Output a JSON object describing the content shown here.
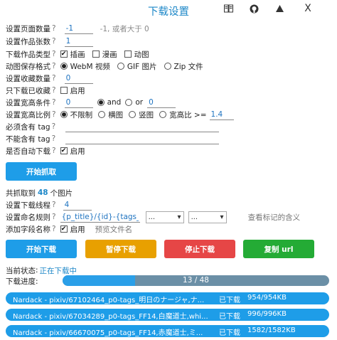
{
  "header": {
    "title": "下载设置",
    "icons": [
      "book-icon",
      "github-icon",
      "triangle-up-icon"
    ],
    "close": "X"
  },
  "settings": {
    "page_count": {
      "label": "设置页面数量",
      "q": "?",
      "value": "-1",
      "hint": "-1, 或者大于 0"
    },
    "work_count": {
      "label": "设置作品张数",
      "q": "?",
      "value": "1"
    },
    "download_type": {
      "label": "下载作品类型",
      "q": "?",
      "options": [
        {
          "label": "插画",
          "checked": true
        },
        {
          "label": "漫画",
          "checked": false
        },
        {
          "label": "动图",
          "checked": false
        }
      ]
    },
    "ugoira_format": {
      "label": "动图保存格式",
      "q": "?",
      "options": [
        {
          "label": "WebM 视频",
          "checked": true
        },
        {
          "label": "GIF 图片",
          "checked": false
        },
        {
          "label": "Zip 文件",
          "checked": false
        }
      ]
    },
    "bookmark_count": {
      "label": "设置收藏数量",
      "q": "?",
      "value": "0"
    },
    "only_bookmarked": {
      "label": "只下载已收藏",
      "q": "?",
      "option": "启用"
    },
    "size_condition": {
      "label": "设置宽高条件",
      "q": "?",
      "width": "0",
      "and": "and",
      "or": "or",
      "height": "0"
    },
    "ratio": {
      "label": "设置宽高比例",
      "q": "?",
      "options": [
        {
          "label": "不限制",
          "checked": true
        },
        {
          "label": "横图",
          "checked": false
        },
        {
          "label": "竖图",
          "checked": false
        },
        {
          "label": "宽高比 >=",
          "checked": false
        }
      ],
      "ratio_value": "1.4"
    },
    "must_tag": {
      "label": "必须含有 tag",
      "q": "?",
      "value": ""
    },
    "exclude_tag": {
      "label": "不能含有 tag",
      "q": "?",
      "value": ""
    },
    "auto_download": {
      "label": "是否自动下载",
      "q": "?",
      "option": "启用"
    }
  },
  "start_button": "开始抓取",
  "crawl_summary": {
    "prefix": "共抓取到",
    "count": "48",
    "suffix": "个图片"
  },
  "threads": {
    "label": "设置下载线程",
    "q": "?",
    "value": "4"
  },
  "naming": {
    "label": "设置命名规则",
    "q": "?",
    "value": "{p_title}/{id}-{tags_trar",
    "select1": "...",
    "select2": "...",
    "link": "查看标记的含义"
  },
  "add_field": {
    "label": "添加字段名称",
    "q": "?",
    "option": "启用",
    "preview": "预览文件名"
  },
  "actions": {
    "start": "开始下载",
    "pause": "暂停下载",
    "stop": "停止下载",
    "copy": "复制 url"
  },
  "state": {
    "label": "当前状态",
    "value": "正在下载中"
  },
  "progress": {
    "label": "下载进度:",
    "text": "13 / 48",
    "done": 13,
    "total": 48
  },
  "downloads": [
    {
      "name": "Nardack - pixiv/67102464_p0-tags_明日のナージャ,ナ...",
      "status": "已下载",
      "size": "954/954KB"
    },
    {
      "name": "Nardack - pixiv/67034289_p0-tags_FF14,白魔道士,whi...",
      "status": "已下载",
      "size": "996/996KB"
    },
    {
      "name": "Nardack - pixiv/66670075_p0-tags_FF14,赤魔道士,ミ...",
      "status": "已下载",
      "size": "1582/1582KB"
    }
  ],
  "colors": {
    "accent": "#1e9de8",
    "title": "#1e88c8",
    "orange": "#e8a000",
    "red": "#e64646",
    "green": "#24ab35"
  }
}
